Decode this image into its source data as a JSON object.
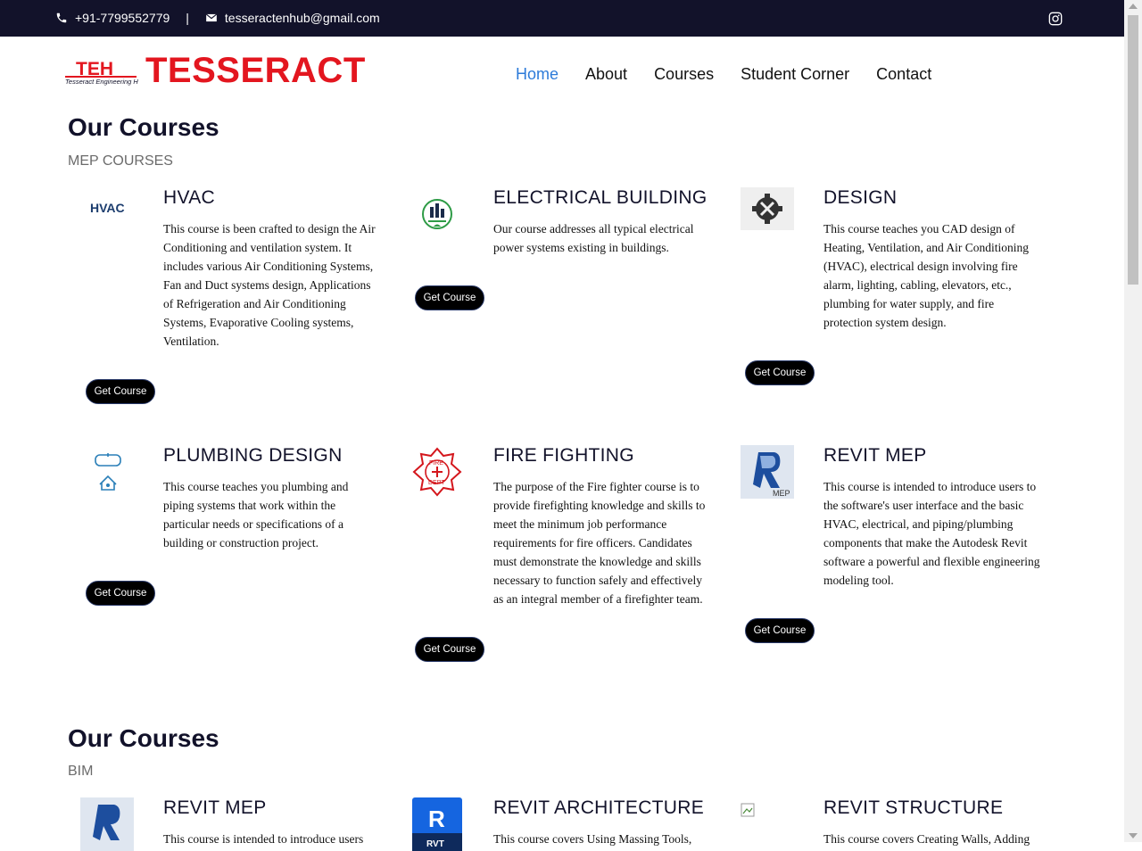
{
  "topbar": {
    "phone": "+91-7799552779",
    "separator": "|",
    "email": "tesseractenhub@gmail.com"
  },
  "header": {
    "logo_mark_text": "TEH",
    "logo_mark_subtext": "Tesseract Engineering Hub",
    "brand": "TESSERACT"
  },
  "nav": [
    "Home",
    "About",
    "Courses",
    "Student Corner",
    "Contact"
  ],
  "sections": [
    {
      "title": "Our Courses",
      "subtitle": "MEP COURSES"
    },
    {
      "title": "Our Courses",
      "subtitle": "BIM"
    }
  ],
  "mep_courses": [
    {
      "title": "HVAC",
      "icon": "hvac-icon",
      "icon_text": "HVAC",
      "description": "This course is been crafted to design the Air Conditioning and ventilation system. It includes various Air Conditioning Systems, Fan and Duct systems design, Applications of Refrigeration and Air Conditioning Systems, Evaporative Cooling systems, Ventilation.",
      "button": "Get Course"
    },
    {
      "title": "ELECTRICAL BUILDING",
      "icon": "electrical-building-icon",
      "description": "Our course addresses all typical electrical power systems existing in buildings.",
      "button": "Get Course"
    },
    {
      "title": "DESIGN",
      "icon": "gear-tools-icon",
      "description": "This course teaches you CAD design of Heating, Ventilation, and Air Conditioning (HVAC), electrical design involving fire alarm, lighting, cabling, elevators, etc., plumbing for water supply, and fire protection system design.",
      "button": "Get Course"
    },
    {
      "title": "PLUMBING DESIGN",
      "icon": "plumbing-icon",
      "description": "This course teaches you plumbing and piping systems that work within the particular needs or specifications of a building or construction project.",
      "button": "Get Course"
    },
    {
      "title": "FIRE FIGHTING",
      "icon": "fire-dept-icon",
      "icon_text_top": "FIRE",
      "icon_text_bottom": "DEPT",
      "description": "The purpose of the Fire fighter course is to provide firefighting knowledge and skills to meet the minimum job performance requirements for fire officers. Candidates must demonstrate the knowledge and skills necessary to function safely and effectively as an integral member of a firefighter team.",
      "button": "Get Course"
    },
    {
      "title": "REVIT MEP",
      "icon": "revit-mep-icon",
      "icon_text": "MEP",
      "description": "This course is intended to introduce users to the software's user interface and the basic HVAC, electrical, and piping/plumbing components that make the Autodesk Revit software a powerful and flexible engineering modeling tool.",
      "button": "Get Course"
    }
  ],
  "bim_courses": [
    {
      "title": "REVIT MEP",
      "icon": "revit-mep-icon",
      "description": "This course is intended to introduce users"
    },
    {
      "title": "REVIT ARCHITECTURE",
      "icon": "revit-rvt-icon",
      "icon_text": "R",
      "icon_subtext": "RVT",
      "description": "This course covers Using Massing Tools,"
    },
    {
      "title": "REVIT STRUCTURE",
      "icon": "broken-image-icon",
      "description": "This course covers Creating Walls, Adding"
    }
  ],
  "colors": {
    "topbar_bg": "#12122a",
    "brand_red": "#e3161f",
    "nav_active": "#2d7bd9",
    "button_bg": "#000000"
  }
}
